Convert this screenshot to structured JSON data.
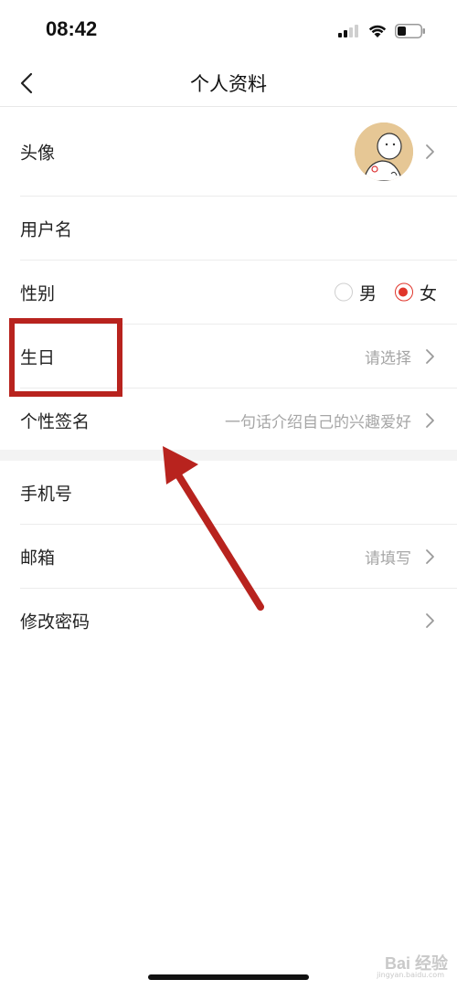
{
  "status_bar": {
    "time": "08:42"
  },
  "nav": {
    "title": "个人资料",
    "back_icon": "chevron-left-icon"
  },
  "profile": {
    "avatar_label": "头像",
    "username_label": "用户名",
    "gender_label": "性别",
    "gender_options": [
      "男",
      "女"
    ],
    "gender_selected": "女",
    "birthday_label": "生日",
    "birthday_value": "请选择",
    "signature_label": "个性签名",
    "signature_placeholder": "一句话介绍自己的兴趣爱好"
  },
  "account": {
    "phone_label": "手机号",
    "email_label": "邮箱",
    "email_value": "请填写",
    "password_label": "修改密码"
  },
  "annotation": {
    "color": "#b8231e"
  },
  "watermark": {
    "text": "Bai 经验",
    "sub": "jingyan.baidu.com"
  },
  "colors": {
    "accent": "#e0352b",
    "placeholder": "#a6a6a6",
    "divider": "#ececec"
  }
}
